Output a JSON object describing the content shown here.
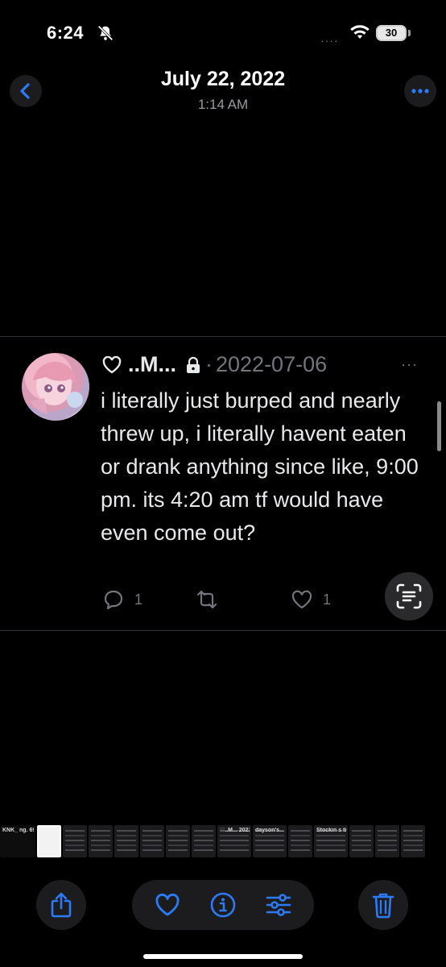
{
  "status_bar": {
    "time": "6:24",
    "battery": "30",
    "signal": "····"
  },
  "header": {
    "date": "July 22, 2022",
    "time": "1:14 AM"
  },
  "tweet": {
    "name": "..M...",
    "separator": "·",
    "date": "2022-07-06",
    "more": "···",
    "text": "i literally just burped and nearly threw up, i literally havent eaten or drank anything since like, 9:00 pm. its 4:20 am tf would have even come out?",
    "replies": "1",
    "likes": "1"
  },
  "thumbnails": [
    {
      "kind": "first",
      "text": "KNK_ ng. 69"
    },
    {
      "kind": "current",
      "text": ""
    },
    {
      "kind": "dark",
      "text": ""
    },
    {
      "kind": "dark",
      "text": ""
    },
    {
      "kind": "dark",
      "text": ""
    },
    {
      "kind": "dark",
      "text": ""
    },
    {
      "kind": "dark",
      "text": ""
    },
    {
      "kind": "dark",
      "text": ""
    },
    {
      "kind": "wide",
      "text": "♡..M... 2022-07"
    },
    {
      "kind": "wide",
      "text": "dayson's... ENING TO h GING BLOOD"
    },
    {
      "kind": "dark",
      "text": ""
    },
    {
      "kind": "wide",
      "text": "Stockin s till sch"
    },
    {
      "kind": "dark",
      "text": ""
    },
    {
      "kind": "dark",
      "text": ""
    },
    {
      "kind": "dark",
      "text": ""
    }
  ],
  "icons": {
    "back": "chevron-left-icon",
    "more": "ellipsis-icon",
    "share": "share-icon",
    "favorite": "heart-icon",
    "info": "info-icon",
    "adjust": "sliders-icon",
    "delete": "trash-icon"
  },
  "colors": {
    "accent": "#2b7bf6",
    "background": "#000000",
    "muted": "#71767b"
  }
}
